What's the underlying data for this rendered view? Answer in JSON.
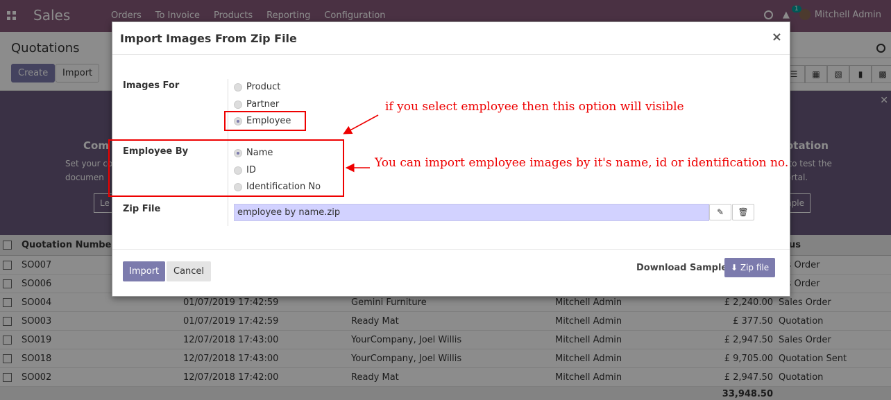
{
  "app": {
    "brand": "Sales",
    "menu": [
      "Orders",
      "To Invoice",
      "Products",
      "Reporting",
      "Configuration"
    ],
    "chat_count": "1",
    "user_name": "Mitchell Admin"
  },
  "control": {
    "breadcrumb": "Quotations",
    "create_label": "Create",
    "import_label": "Import"
  },
  "banner": {
    "left_title": "Com",
    "left_line1": "Set your co",
    "left_line2": "documen",
    "left_button": "Le",
    "right_title": "otation",
    "right_line1": "n to test the",
    "right_line2": "portal.",
    "right_button": "mple"
  },
  "list": {
    "headers": {
      "number": "Quotation Number",
      "status": "atus"
    },
    "rows": [
      {
        "number": "SO007",
        "date": "",
        "customer": "",
        "salesperson": "",
        "total": "",
        "status": "les Order"
      },
      {
        "number": "SO006",
        "date": "",
        "customer": "",
        "salesperson": "",
        "total": "",
        "status": "les Order"
      },
      {
        "number": "SO004",
        "date": "01/07/2019 17:42:59",
        "customer": "Gemini Furniture",
        "salesperson": "Mitchell Admin",
        "total": "£ 2,240.00",
        "status": "Sales Order"
      },
      {
        "number": "SO003",
        "date": "01/07/2019 17:42:59",
        "customer": "Ready Mat",
        "salesperson": "Mitchell Admin",
        "total": "£ 377.50",
        "status": "Quotation"
      },
      {
        "number": "SO019",
        "date": "12/07/2018 17:43:00",
        "customer": "YourCompany, Joel Willis",
        "salesperson": "Mitchell Admin",
        "total": "£ 2,947.50",
        "status": "Sales Order"
      },
      {
        "number": "SO018",
        "date": "12/07/2018 17:43:00",
        "customer": "YourCompany, Joel Willis",
        "salesperson": "Mitchell Admin",
        "total": "£ 9,705.00",
        "status": "Quotation Sent"
      },
      {
        "number": "SO002",
        "date": "12/07/2018 17:42:00",
        "customer": "Ready Mat",
        "salesperson": "Mitchell Admin",
        "total": "£ 2,947.50",
        "status": "Quotation"
      }
    ],
    "sum": "33,948.50"
  },
  "modal": {
    "title": "Import Images From Zip File",
    "close": "×",
    "images_for_label": "Images For",
    "images_for_options": [
      "Product",
      "Partner",
      "Employee"
    ],
    "images_for_selected": "Employee",
    "employee_by_label": "Employee By",
    "employee_by_options": [
      "Name",
      "ID",
      "Identification No"
    ],
    "employee_by_selected": "Name",
    "zip_label": "Zip File",
    "zip_value": "employee by name.zip",
    "import_button": "Import",
    "cancel_button": "Cancel",
    "download_label": "Download Sample:",
    "zip_button": "Zip file"
  },
  "annotations": {
    "note1": "if you select employee then this option will visible",
    "note2": "You can import employee images by it's name, id or identification no."
  },
  "colors": {
    "topbar": "#875a7b",
    "primary": "#7c7bad",
    "annotation": "#e00000"
  }
}
